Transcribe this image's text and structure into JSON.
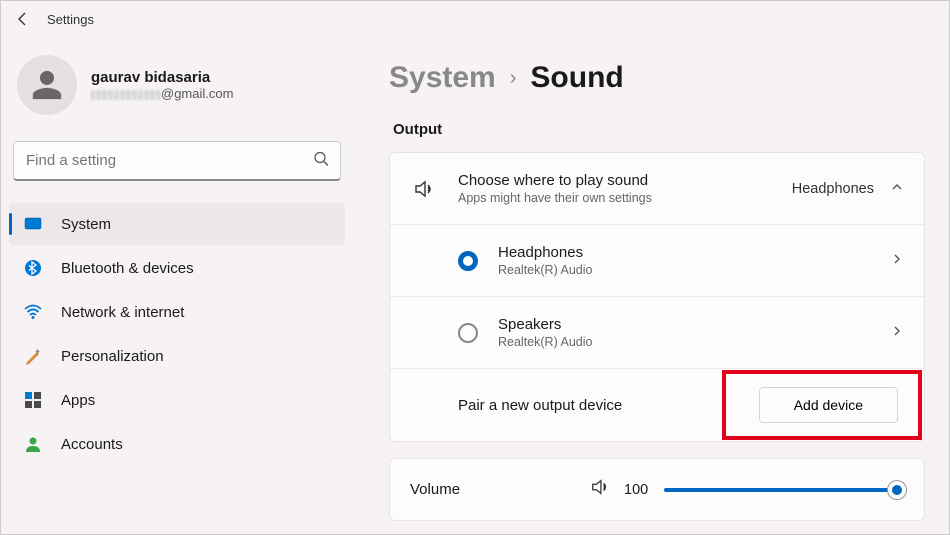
{
  "titlebar": {
    "title": "Settings"
  },
  "profile": {
    "name": "gaurav bidasaria",
    "email_suffix": "@gmail.com"
  },
  "search": {
    "placeholder": "Find a setting"
  },
  "nav": {
    "items": [
      {
        "label": "System"
      },
      {
        "label": "Bluetooth & devices"
      },
      {
        "label": "Network & internet"
      },
      {
        "label": "Personalization"
      },
      {
        "label": "Apps"
      },
      {
        "label": "Accounts"
      }
    ]
  },
  "breadcrumb": {
    "root": "System",
    "current": "Sound"
  },
  "output": {
    "section": "Output",
    "choose_title": "Choose where to play sound",
    "choose_sub": "Apps might have their own settings",
    "selected_label": "Headphones",
    "devices": [
      {
        "name": "Headphones",
        "sub": "Realtek(R) Audio"
      },
      {
        "name": "Speakers",
        "sub": "Realtek(R) Audio"
      }
    ],
    "pair_label": "Pair a new output device",
    "add_btn": "Add device"
  },
  "volume": {
    "label": "Volume",
    "value": "100"
  }
}
